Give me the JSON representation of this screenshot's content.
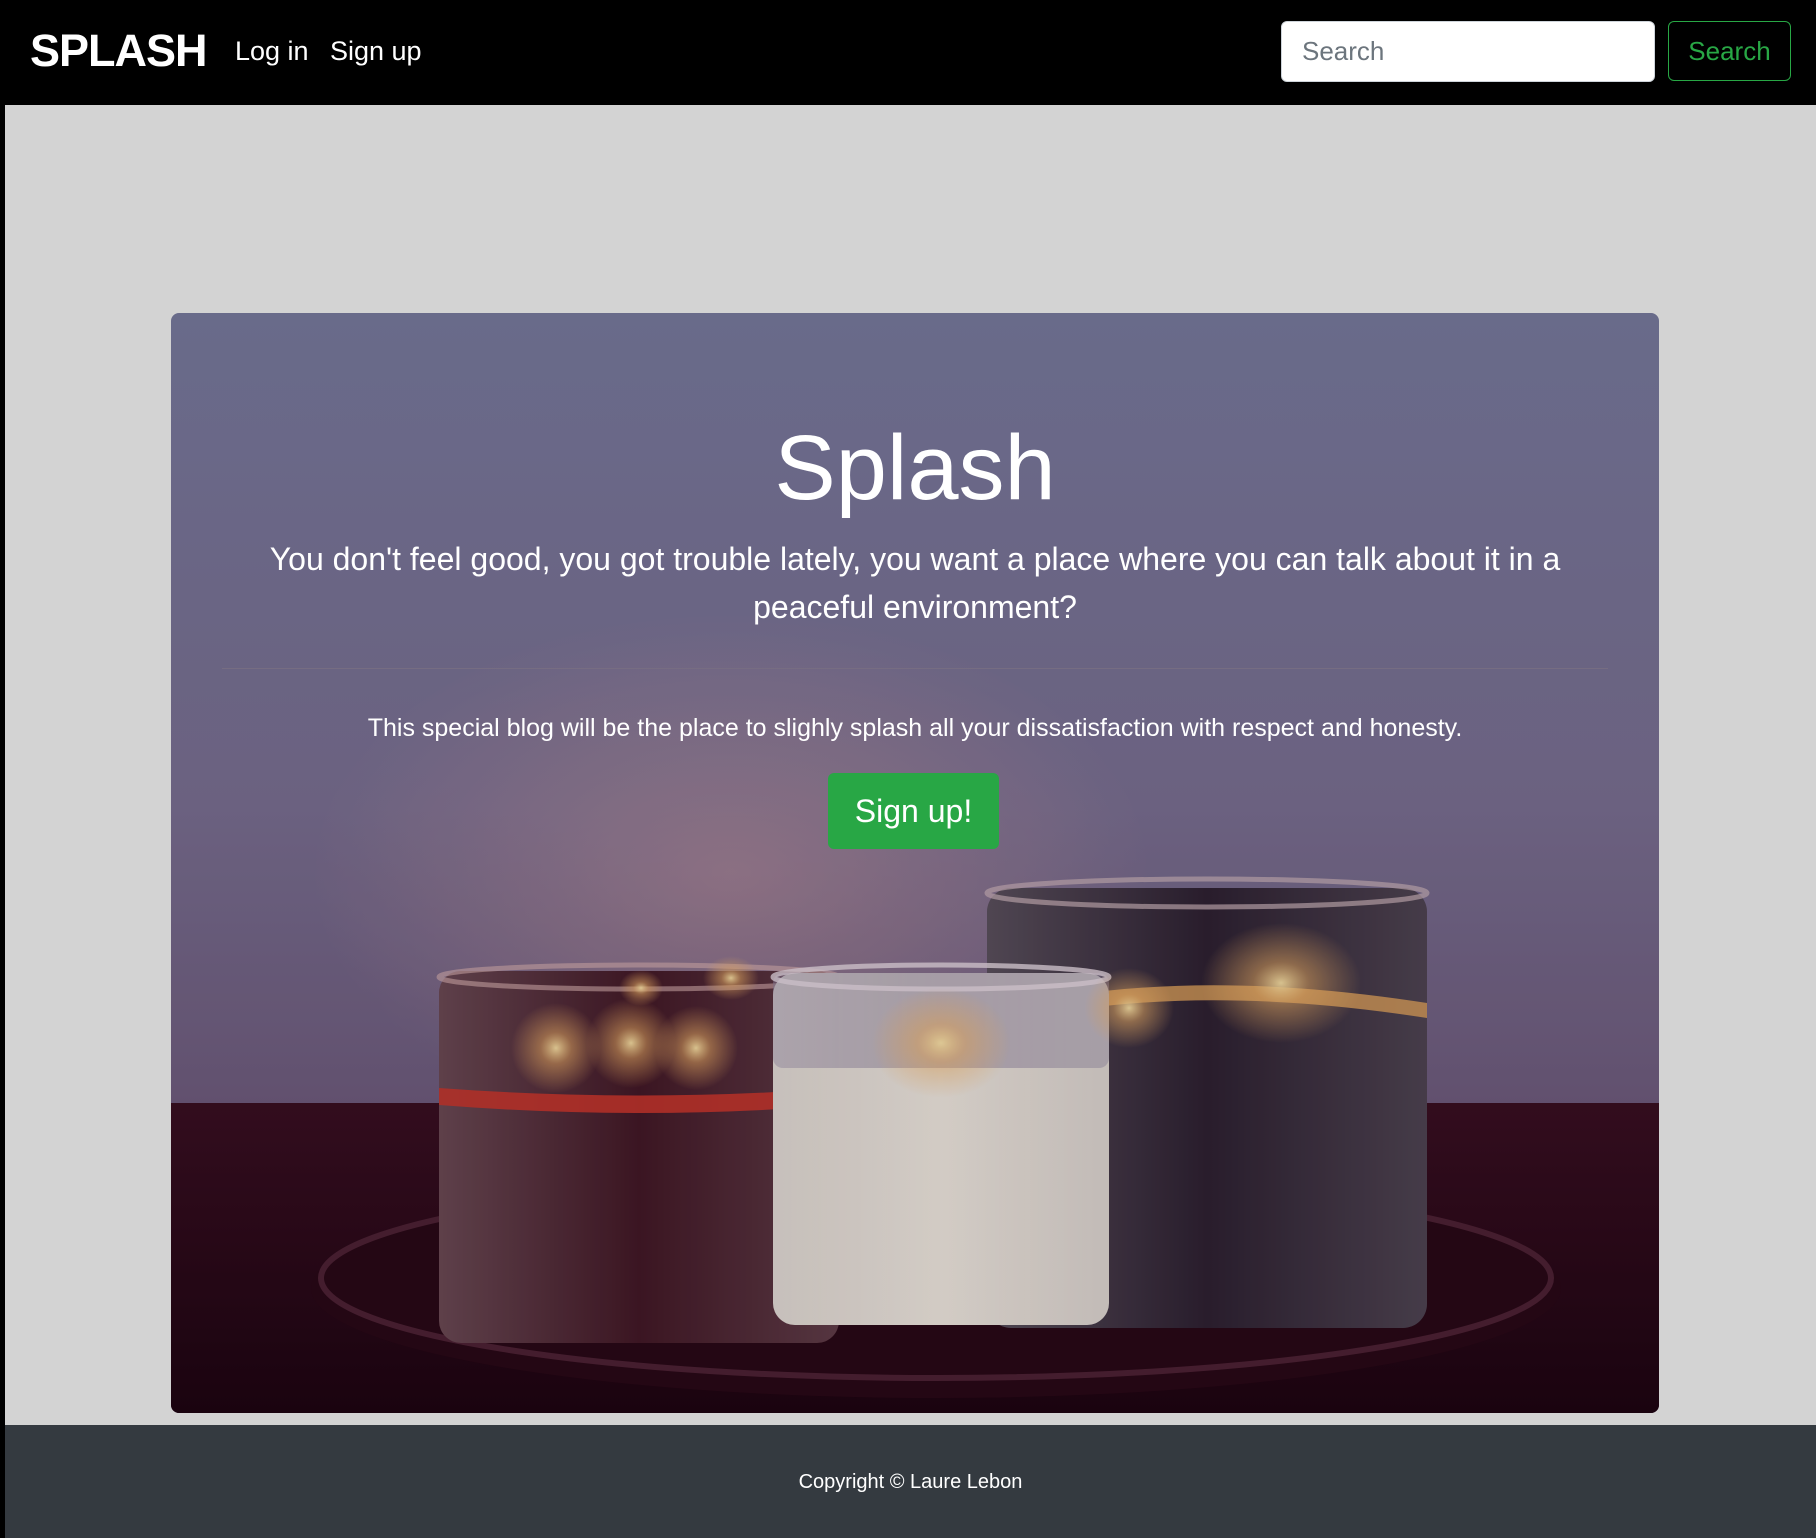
{
  "navbar": {
    "brand": "SPLASH",
    "links": [
      {
        "label": "Log in"
      },
      {
        "label": "Sign up"
      }
    ],
    "search": {
      "placeholder": "Search",
      "button_label": "Search"
    }
  },
  "hero": {
    "title": "Splash",
    "lead": "You don't feel good, you got trouble lately, you want a place where you can talk about it in a peaceful environment?",
    "text": "This special blog will be the place to slighly splash all your dissatisfaction with respect and honesty.",
    "cta_label": "Sign up!",
    "image": "candles-photo"
  },
  "footer": {
    "copyright": "Copyright © Laure Lebon"
  },
  "colors": {
    "navbar_bg": "#000000",
    "page_bg": "#d3d3d3",
    "accent_green": "#28a745",
    "footer_bg": "#343a40"
  }
}
